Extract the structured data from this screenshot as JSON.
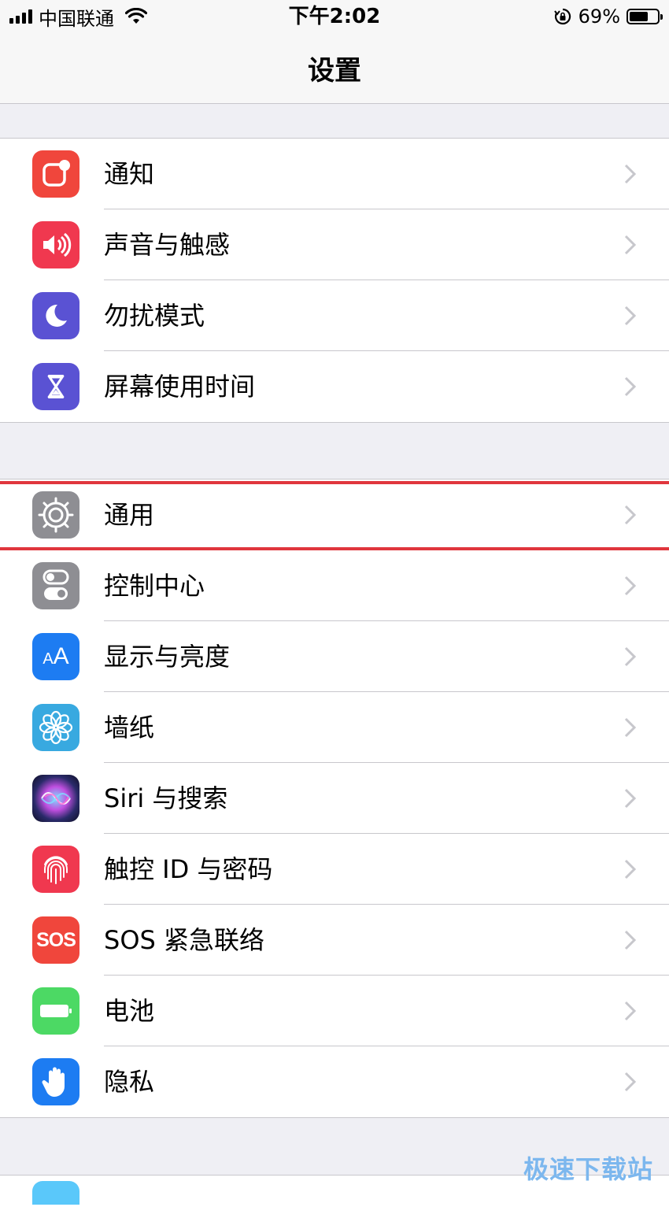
{
  "status_bar": {
    "carrier": "中国联通",
    "time": "下午2:02",
    "battery_percent": "69%",
    "battery_level": 0.69
  },
  "nav": {
    "title": "设置"
  },
  "groups": [
    {
      "items": [
        {
          "label": "通知",
          "icon": "notifications-icon",
          "color": "#f0463c"
        },
        {
          "label": "声音与触感",
          "icon": "sound-icon",
          "color": "#f0384f"
        },
        {
          "label": "勿扰模式",
          "icon": "moon-icon",
          "color": "#5a52d3"
        },
        {
          "label": "屏幕使用时间",
          "icon": "hourglass-icon",
          "color": "#5a52d3"
        }
      ]
    },
    {
      "items": [
        {
          "label": "通用",
          "icon": "gear-icon",
          "color": "#8e8e93"
        },
        {
          "label": "控制中心",
          "icon": "toggle-icon",
          "color": "#8e8e93"
        },
        {
          "label": "显示与亮度",
          "icon": "text-size-icon",
          "color": "#1d7cf2",
          "icon_text": "AA"
        },
        {
          "label": "墙纸",
          "icon": "flower-icon",
          "color": "#38a9e0"
        },
        {
          "label": "Siri 与搜索",
          "icon": "siri-icon",
          "color": "#1b1b3a"
        },
        {
          "label": "触控 ID 与密码",
          "icon": "fingerprint-icon",
          "color": "#f0384f"
        },
        {
          "label": "SOS 紧急联络",
          "icon": "sos-icon",
          "color": "#f0463c",
          "icon_text": "SOS"
        },
        {
          "label": "电池",
          "icon": "battery-icon",
          "color": "#4cd964"
        },
        {
          "label": "隐私",
          "icon": "hand-icon",
          "color": "#1d7cf2"
        }
      ]
    }
  ],
  "watermark": "极速下载站"
}
